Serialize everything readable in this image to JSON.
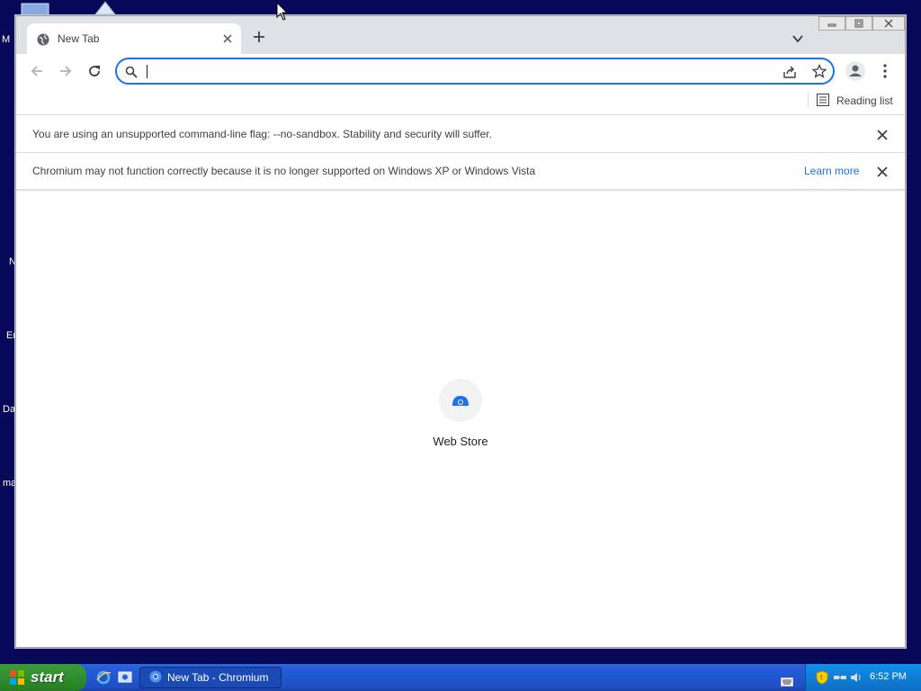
{
  "desktop": {
    "labels": [
      "M",
      "N",
      "Er",
      "Da",
      "ma"
    ]
  },
  "browser": {
    "tab": {
      "title": "New Tab"
    },
    "omnibox": {
      "value": "",
      "placeholder": ""
    },
    "bookmarks_bar": {
      "reading_list_label": "Reading list"
    },
    "infobars": [
      {
        "text": "You are using an unsupported command-line flag: --no-sandbox. Stability and security will suffer."
      },
      {
        "text": "Chromium may not function correctly because it is no longer supported on Windows XP or Windows Vista",
        "link": "Learn more"
      }
    ],
    "ntp": {
      "shortcut_label": "Web Store"
    }
  },
  "taskbar": {
    "start_label": "start",
    "task_button_label": "New Tab - Chromium",
    "clock": "6:52 PM"
  },
  "colors": {
    "accent": "#1a73e8",
    "desktop_bg": "#080858",
    "taskbar": "#245edb",
    "start_green": "#2f8b2c"
  }
}
